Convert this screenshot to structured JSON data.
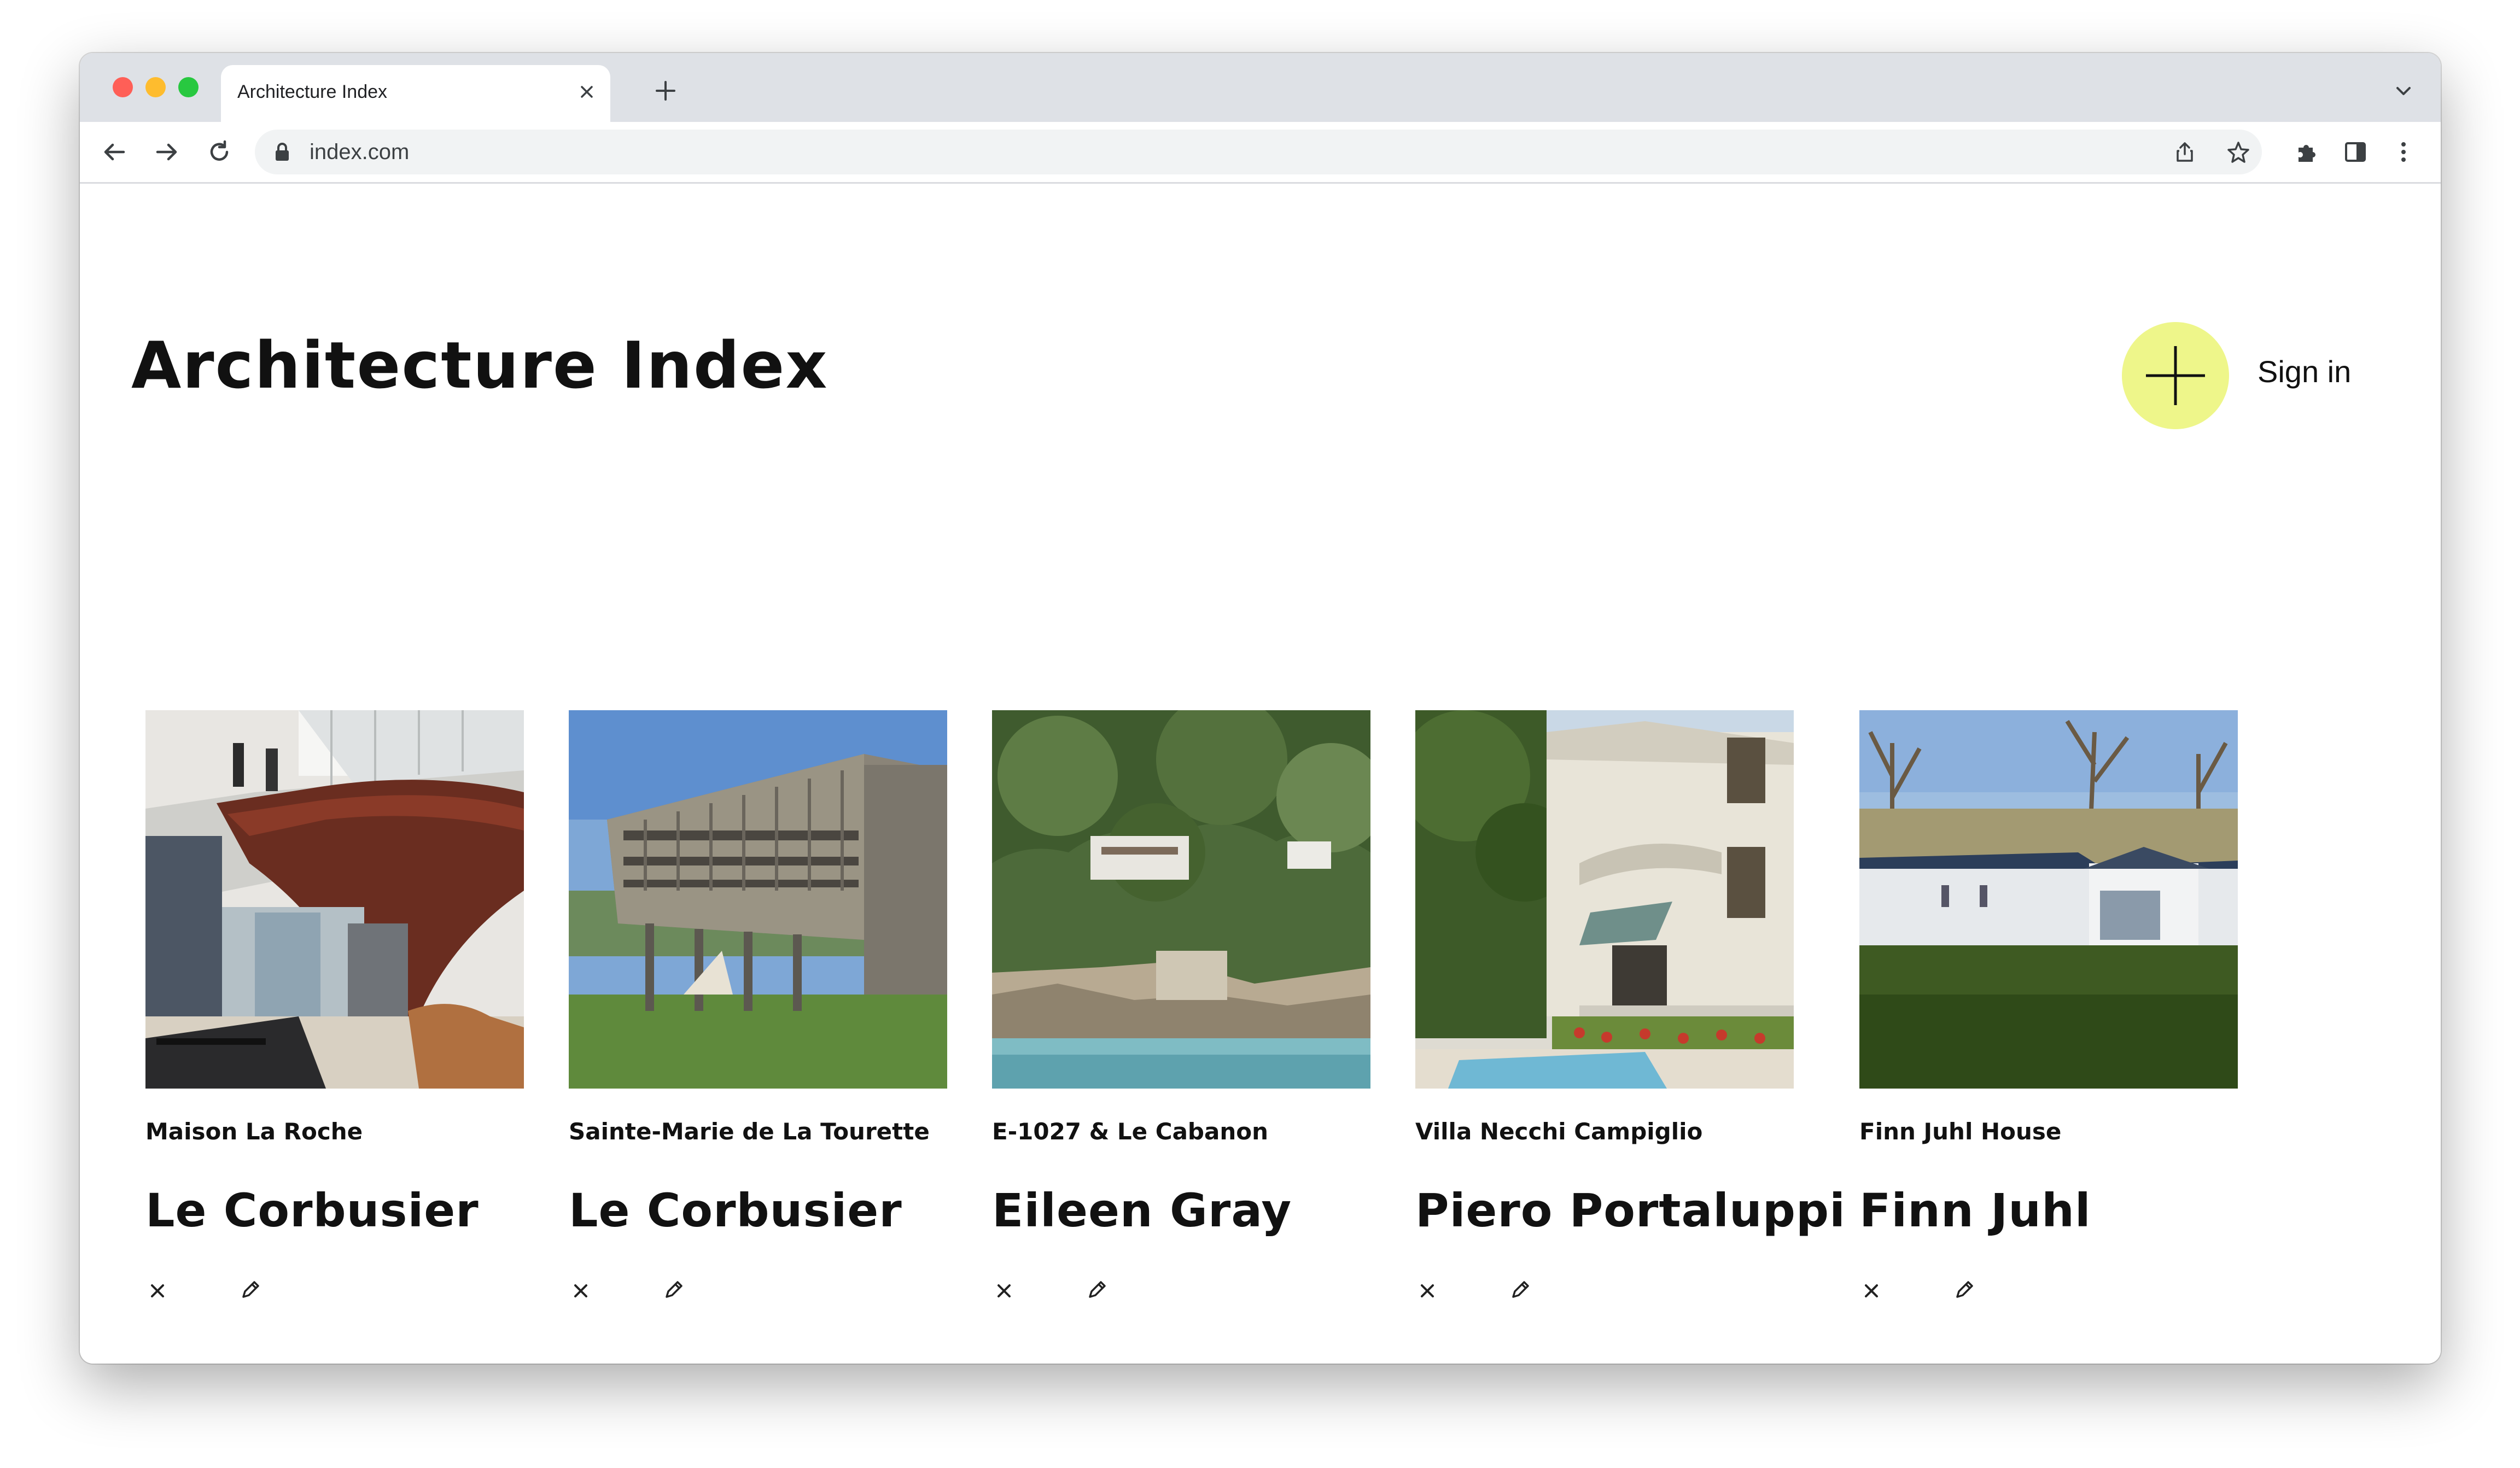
{
  "browser": {
    "tab_title": "Architecture Index",
    "url": "index.com"
  },
  "page": {
    "title": "Architecture Index",
    "signin_label": "Sign in",
    "accent_color": "#eef68a"
  },
  "entries": [
    {
      "building": "Maison La Roche",
      "architect": "Le Corbusier"
    },
    {
      "building": "Sainte-Marie de La Tourette",
      "architect": "Le Corbusier"
    },
    {
      "building": "E-1027 & Le Cabanon",
      "architect": "Eileen Gray"
    },
    {
      "building": "Villa Necchi Campiglio",
      "architect": "Piero Portaluppi"
    },
    {
      "building": "Finn Juhl House",
      "architect": "Finn Juhl"
    }
  ],
  "icons": {
    "delete": "close-icon",
    "edit": "pencil-icon",
    "add": "plus-icon"
  }
}
